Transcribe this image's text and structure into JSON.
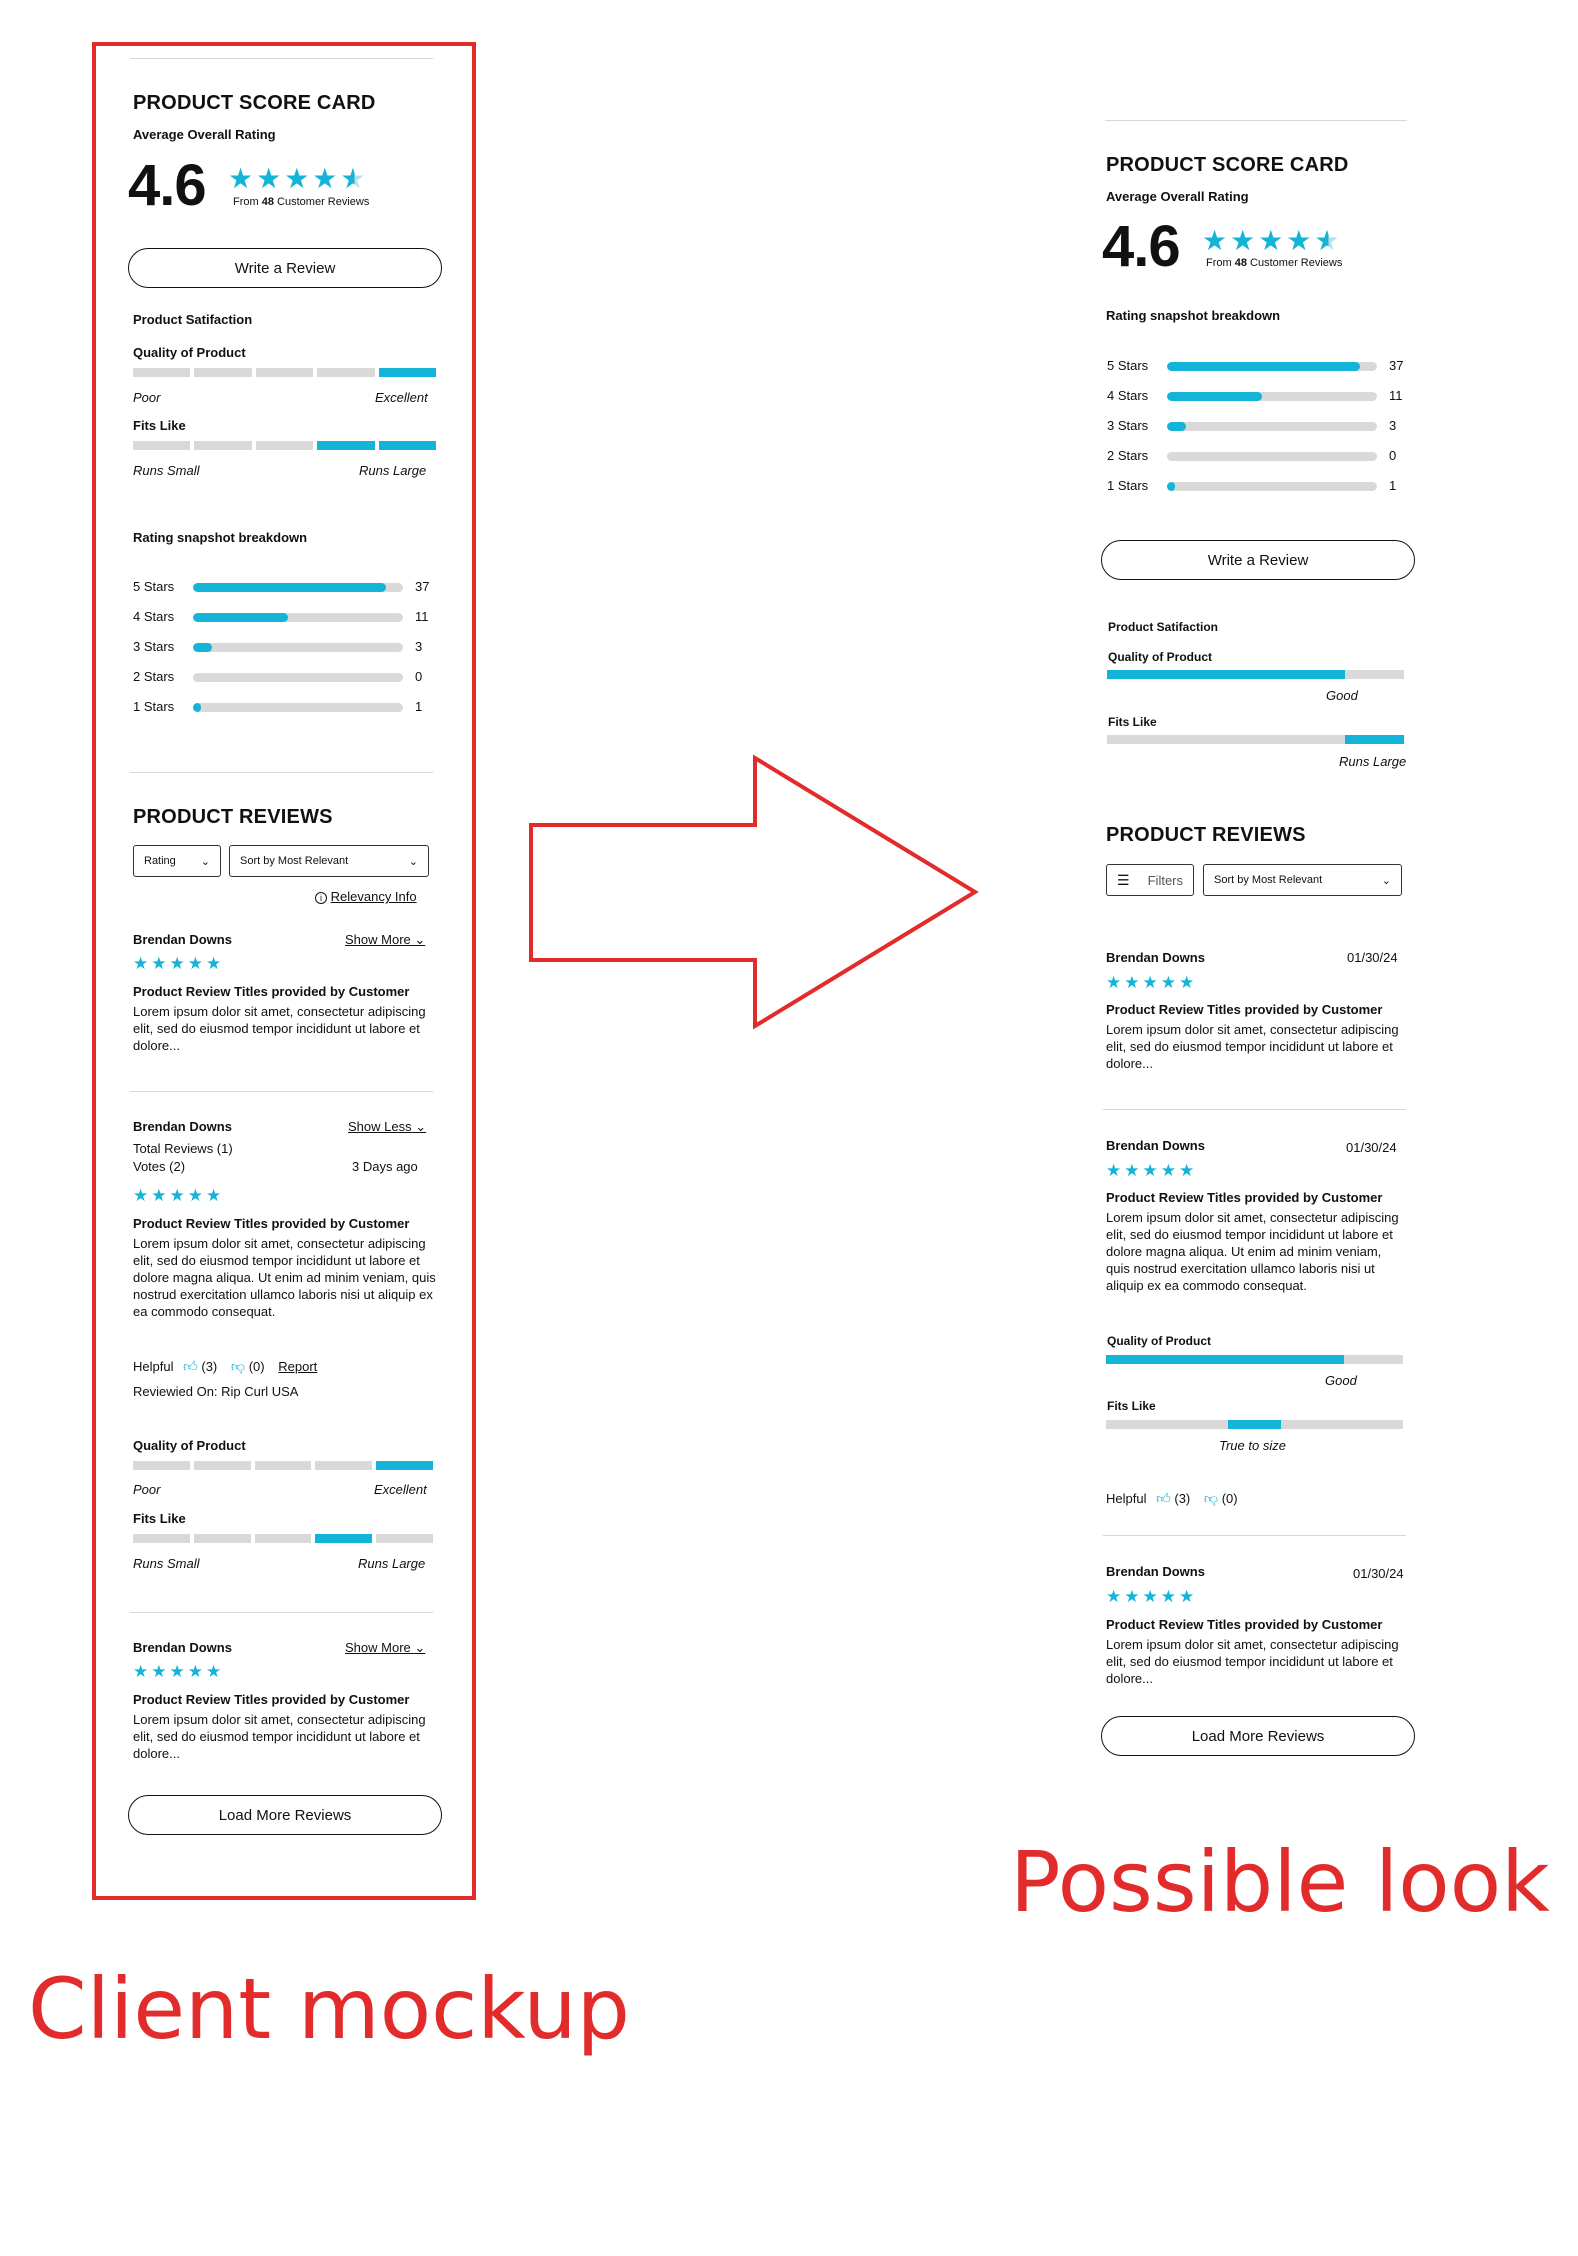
{
  "colors": {
    "accent": "#13b4d8",
    "annotation": "#e22b2b",
    "track": "#d9d9d9"
  },
  "icons": {
    "star": "★",
    "chevron": "chevron-down-icon",
    "info": "info-icon",
    "filter": "filter-sliders-icon",
    "thumb_up": "thumbs-up-icon",
    "thumb_down": "thumbs-down-icon",
    "arrow": "right-arrow-outline"
  },
  "captions": {
    "left": "Client mockup",
    "right": "Possible look"
  },
  "left": {
    "scorecard": {
      "title": "PRODUCT SCORE CARD",
      "avg_label": "Average Overall Rating",
      "avg": "4.6",
      "stars": 4.6,
      "from_prefix": "From",
      "count": "48",
      "from_suffix": "Customer Reviews"
    },
    "write_review": "Write a Review",
    "satisfaction": {
      "title": "Product Satifaction",
      "quality": {
        "label": "Quality of Product",
        "low": "Poor",
        "high": "Excellent",
        "filled": [
          4
        ]
      },
      "fits": {
        "label": "Fits Like",
        "low": "Runs Small",
        "high": "Runs Large",
        "filled": [
          3,
          4
        ]
      }
    },
    "breakdown": {
      "title": "Rating snapshot breakdown",
      "rows": [
        {
          "label": "5 Stars",
          "count": "37",
          "fraction": 0.92
        },
        {
          "label": "4 Stars",
          "count": "11",
          "fraction": 0.45
        },
        {
          "label": "3 Stars",
          "count": "3",
          "fraction": 0.09
        },
        {
          "label": "2 Stars",
          "count": "0",
          "fraction": 0
        },
        {
          "label": "1 Stars",
          "count": "1",
          "fraction": 0.04
        }
      ]
    },
    "reviews_title": "PRODUCT REVIEWS",
    "rating_select": "Rating",
    "sort_select": "Sort by Most Relevant",
    "relevancy": "Relevancy Info",
    "review1": {
      "author": "Brendan Downs",
      "toggle": "Show More",
      "title": "Product Review Titles provided by Customer",
      "body": "Lorem ipsum dolor sit amet, consectetur adipiscing elit, sed do eiusmod tempor incididunt ut labore et dolore..."
    },
    "review2": {
      "author": "Brendan Downs",
      "toggle": "Show Less",
      "total": "Total Reviews (1)",
      "votes": "Votes (2)",
      "age": "3 Days ago",
      "title": "Product Review Titles provided by Customer",
      "body": "Lorem ipsum dolor sit amet, consectetur adipiscing elit, sed do eiusmod tempor incididunt ut labore et dolore magna aliqua. Ut enim ad minim veniam, quis nostrud exercitation ullamco laboris nisi ut aliquip ex ea commodo consequat.",
      "helpful": "Helpful",
      "up": "(3)",
      "down": "(0)",
      "report": "Report",
      "reviewed_on": "Reviewied On: Rip Curl USA",
      "quality": {
        "label": "Quality of Product",
        "low": "Poor",
        "high": "Excellent",
        "filled": [
          4
        ]
      },
      "fits": {
        "label": "Fits Like",
        "low": "Runs Small",
        "high": "Runs Large",
        "filled": [
          3
        ]
      }
    },
    "review3": {
      "author": "Brendan Downs",
      "toggle": "Show More",
      "title": "Product Review Titles provided by Customer",
      "body": "Lorem ipsum dolor sit amet, consectetur adipiscing elit, sed do eiusmod tempor incididunt ut labore et dolore..."
    },
    "load_more": "Load More Reviews"
  },
  "right": {
    "scorecard": {
      "title": "PRODUCT SCORE CARD",
      "avg_label": "Average Overall Rating",
      "avg": "4.6",
      "stars": 4.6,
      "from_prefix": "From",
      "count": "48",
      "from_suffix": "Customer Reviews"
    },
    "breakdown": {
      "title": "Rating snapshot breakdown",
      "rows": [
        {
          "label": "5 Stars",
          "count": "37",
          "fraction": 0.92
        },
        {
          "label": "4 Stars",
          "count": "11",
          "fraction": 0.45
        },
        {
          "label": "3 Stars",
          "count": "3",
          "fraction": 0.09
        },
        {
          "label": "2 Stars",
          "count": "0",
          "fraction": 0
        },
        {
          "label": "1 Stars",
          "count": "1",
          "fraction": 0.04
        }
      ]
    },
    "write_review": "Write a Review",
    "satisfaction": {
      "title": "Product Satifaction",
      "quality": {
        "label": "Quality of Product",
        "value": "Good",
        "fraction": 0.8
      },
      "fits": {
        "label": "Fits Like",
        "value": "Runs Large",
        "from": 0.8,
        "to": 1.0
      }
    },
    "reviews_title": "PRODUCT REVIEWS",
    "filters": "Filters",
    "sort_select": "Sort by Most Relevant",
    "review1": {
      "author": "Brendan Downs",
      "date": "01/30/24",
      "title": "Product Review Titles provided by Customer",
      "body": "Lorem ipsum dolor sit amet, consectetur adipiscing elit, sed do eiusmod tempor incididunt ut labore et dolore..."
    },
    "review2": {
      "author": "Brendan Downs",
      "date": "01/30/24",
      "title": "Product Review Titles provided by Customer",
      "body": "Lorem ipsum dolor sit amet, consectetur adipiscing elit, sed do eiusmod tempor incididunt ut labore et dolore magna aliqua. Ut enim ad minim veniam, quis nostrud exercitation ullamco laboris nisi ut aliquip ex ea commodo consequat.",
      "quality": {
        "label": "Quality of Product",
        "value": "Good",
        "fraction": 0.8
      },
      "fits": {
        "label": "Fits Like",
        "value": "True to size",
        "from": 0.41,
        "to": 0.59
      },
      "helpful": "Helpful",
      "up": "(3)",
      "down": "(0)"
    },
    "review3": {
      "author": "Brendan Downs",
      "date": "01/30/24",
      "title": "Product Review Titles provided by Customer",
      "body": "Lorem ipsum dolor sit amet, consectetur adipiscing elit, sed do eiusmod tempor incididunt ut labore et dolore..."
    },
    "load_more": "Load More Reviews"
  }
}
